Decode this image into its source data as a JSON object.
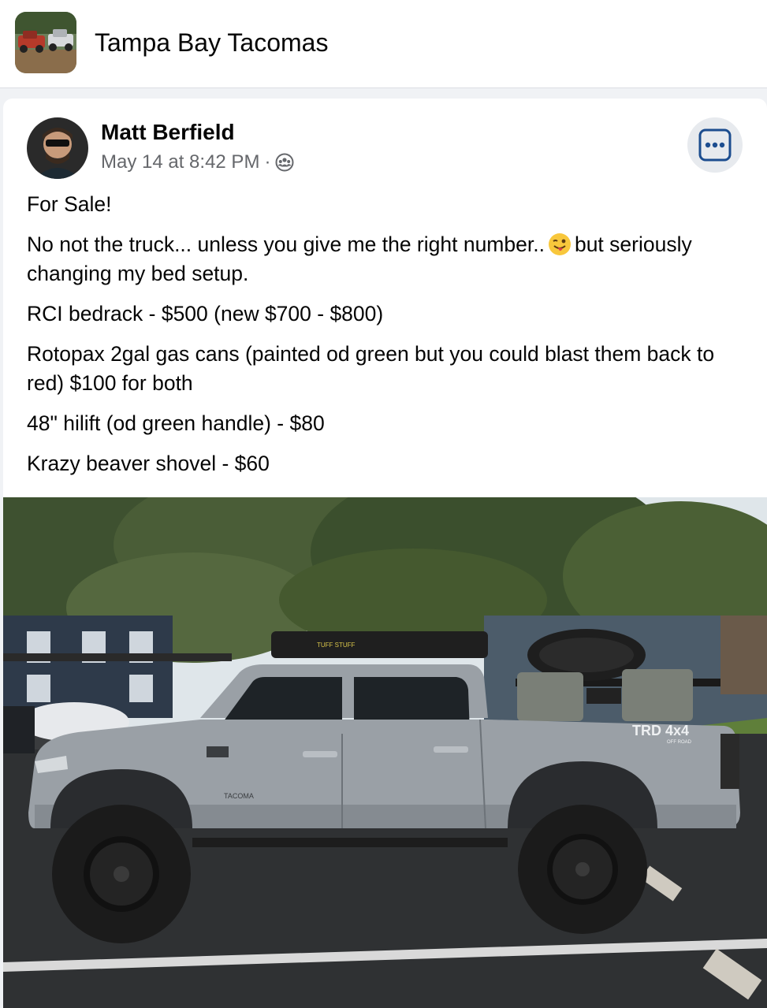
{
  "group": {
    "name": "Tampa Bay Tacomas",
    "avatar_icon": "group-photo-truck-icon"
  },
  "post": {
    "author": "Matt Berfield",
    "timestamp": "May 14 at 8:42 PM",
    "separator": "·",
    "privacy_icon": "group-members-icon",
    "more_icon": "more-options-icon",
    "lines": {
      "line1": "For Sale!",
      "line2a": "No not the truck... unless you give me the right number..",
      "line2b": "but seriously changing my bed setup.",
      "line3": "RCI bedrack - $500 (new $700 - $800)",
      "line4": "Rotopax 2gal gas cans (painted od green but you could blast them back to red) $100 for both",
      "line5": "48\" hilift (od green handle) - $80",
      "line6": "Krazy beaver shovel - $60"
    },
    "emoji": "winking-face-with-tongue-emoji",
    "image": {
      "badge_text": "TRD 4x4",
      "badge_sub": "OFF ROAD",
      "tailgate_badge": "TACOMA",
      "tent_logo": "TUFF STUFF"
    }
  },
  "colors": {
    "truck_body": "#9aa0a6",
    "sky": "#dfe6ea",
    "trees": "#3e5130",
    "asphalt": "#2f3133",
    "grass": "#5f7f3a",
    "accent_blue": "#1c4d8f"
  }
}
